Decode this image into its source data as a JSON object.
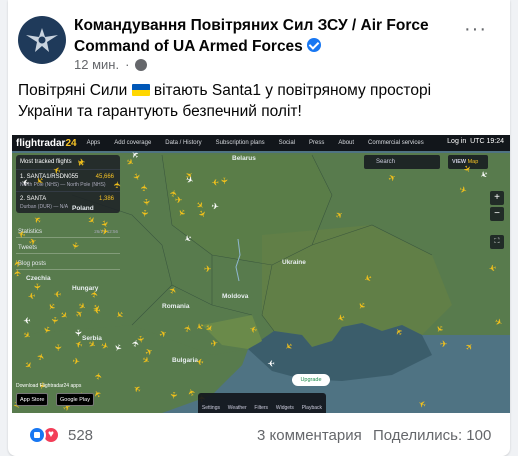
{
  "post": {
    "page_name": "Командування Повітряних Сил ЗСУ / Air Force Command of UA Armed Forces",
    "time": "12 мин.",
    "text_before_flag": "Повітряні Сили",
    "text_after_flag": "вітають Santa1 у повітряному просторі України та гарантують безпечний політ!",
    "more_label": "···"
  },
  "fr24": {
    "logo_main": "flightradar",
    "logo_num": "24",
    "nav": [
      "Apps",
      "Add coverage",
      "Data / History",
      "Subscription plans",
      "Social",
      "Press",
      "About",
      "Commercial services"
    ],
    "login": "Log in",
    "utc": "UTC",
    "time": "19:24",
    "panel_title": "Most tracked flights",
    "flights": [
      {
        "code": "1. SANTA1/RSDN055",
        "count": "45,666",
        "route": "North Pole (NHS) — North Pole (NHS)"
      },
      {
        "code": "2. SANTA",
        "count": "1,386",
        "route": "Durban (DUR) — N/A"
      }
    ],
    "statistics": "Statistics",
    "stats_value": "26/17 12:56",
    "tweets": "Tweets",
    "blog": "Blog posts",
    "search_placeholder": "Search",
    "view_label": "VIEW",
    "view_value": "Map",
    "upgrade": "Upgrade",
    "download_label": "Download Flightradar24 apps",
    "app_store": "App Store",
    "google_play": "Google Play",
    "bottom": [
      "Settings",
      "Weather",
      "Filters",
      "Widgets",
      "Playback"
    ],
    "zoom_in": "+",
    "zoom_out": "−",
    "labels": {
      "belarus": "Belarus",
      "poland": "Poland",
      "ukraine": "Ukraine",
      "moldova": "Moldova",
      "romania": "Romania",
      "hungary": "Hungary",
      "bulgaria": "Bulgaria",
      "serbia": "Serbia",
      "czechia": "Czechia"
    }
  },
  "footer": {
    "reactions": "528",
    "comments": "3 комментария",
    "shares": "Поделились: 100"
  }
}
